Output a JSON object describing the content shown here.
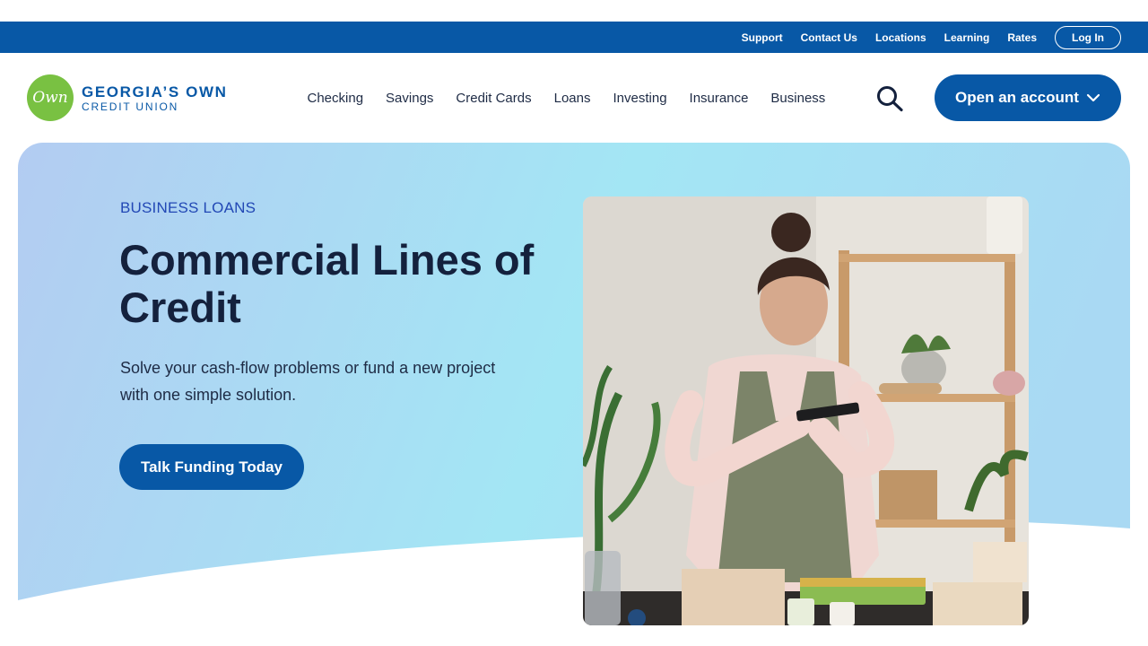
{
  "utility_nav": {
    "links": [
      "Support",
      "Contact Us",
      "Locations",
      "Learning",
      "Rates"
    ],
    "login_label": "Log In"
  },
  "logo": {
    "mark": "Own",
    "line1": "GEORGIA’S OWN",
    "line2": "CREDIT UNION",
    "brand_green": "#79c142",
    "brand_blue": "#0858a6"
  },
  "main_nav": {
    "items": [
      "Checking",
      "Savings",
      "Credit Cards",
      "Loans",
      "Investing",
      "Insurance",
      "Business"
    ],
    "search_icon": "search-icon",
    "open_account_label": "Open an account",
    "open_account_icon": "chevron-down-icon"
  },
  "hero": {
    "eyebrow": "BUSINESS LOANS",
    "title": "Commercial Lines of Credit",
    "subtitle": "Solve your cash-flow problems or fund a new project with one simple solution.",
    "cta_label": "Talk Funding Today",
    "photo_subject": "woman photographing handmade soap bars with a phone",
    "colors": {
      "gradient_left": "#b3ccf2",
      "gradient_right": "#a3e6f4",
      "accent": "#0858a6"
    }
  }
}
